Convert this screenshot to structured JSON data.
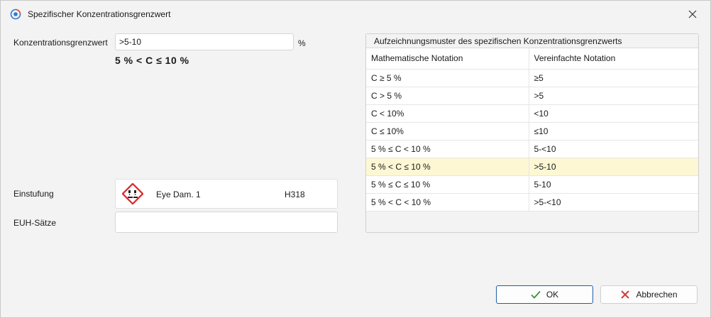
{
  "window": {
    "title": "Spezifischer Konzentrationsgrenzwert"
  },
  "form": {
    "limit_label": "Konzentrationsgrenzwert",
    "limit_value": ">5-10",
    "limit_unit": "%",
    "notation_display": "5 % < C ≤ 10 %",
    "classification_label": "Einstufung",
    "classification": {
      "icon": "ghs05-corrosion-icon",
      "name": "Eye Dam. 1",
      "code": "H318"
    },
    "euh_label": "EUH-Sätze",
    "euh_value": ""
  },
  "pattern_panel": {
    "title": "Aufzeichnungsmuster des spezifischen Konzentrationsgrenzwerts",
    "columns": [
      "Mathematische Notation",
      "Vereinfachte Notation"
    ],
    "rows": [
      {
        "math": "C ≥ 5 %",
        "simple": "≥5"
      },
      {
        "math": "C > 5 %",
        "simple": ">5"
      },
      {
        "math": "C < 10%",
        "simple": "<10"
      },
      {
        "math": "C ≤ 10%",
        "simple": "≤10"
      },
      {
        "math": "5 % ≤ C < 10 %",
        "simple": "5-<10"
      },
      {
        "math": "5 % < C ≤ 10 %",
        "simple": ">5-10"
      },
      {
        "math": "5 % ≤ C ≤ 10 %",
        "simple": "5-10"
      },
      {
        "math": "5 % < C < 10 %",
        "simple": ">5-<10"
      }
    ],
    "highlight_color": "#fdf7d4"
  },
  "buttons": {
    "ok": "OK",
    "cancel": "Abbrechen"
  },
  "colors": {
    "primary_border": "#1f5fa8",
    "ok_check": "#3a8f3a",
    "cancel_x": "#d23a3a",
    "ghs_red": "#e0242a"
  }
}
